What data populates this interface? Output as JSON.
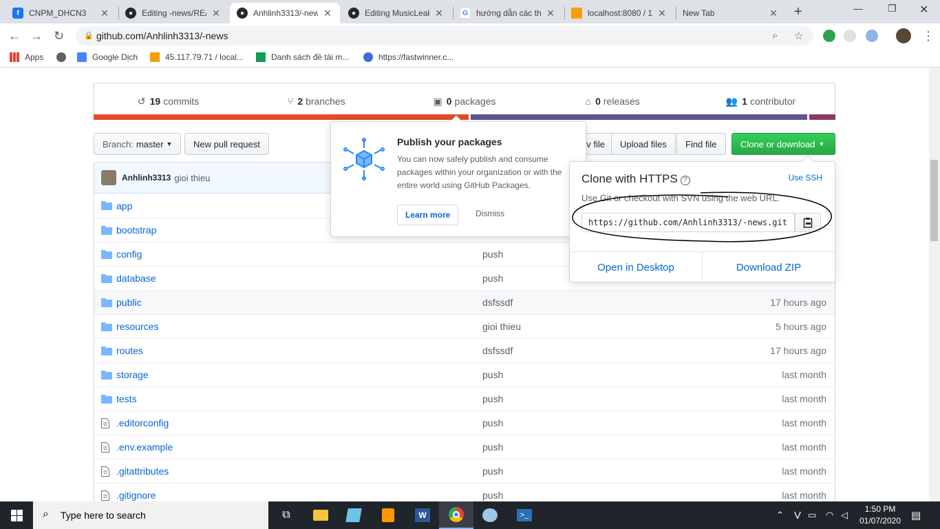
{
  "browser": {
    "tabs": [
      {
        "title": "CNPM_DHCN3",
        "icon": "facebook-icon"
      },
      {
        "title": "Editing -news/REA",
        "icon": "github-icon"
      },
      {
        "title": "Anhlinh3313/-new",
        "icon": "github-icon"
      },
      {
        "title": "Editing MusicLeak",
        "icon": "github-icon"
      },
      {
        "title": "hướng dẫn các tha",
        "icon": "google-icon"
      },
      {
        "title": "localhost:8080 / 1:",
        "icon": "phpmyadmin-icon"
      },
      {
        "title": "New Tab",
        "icon": ""
      }
    ],
    "new_tab": "+",
    "address": "github.com/Anhlinh3313/-news",
    "bookmarks": [
      "Apps",
      "Google Dịch",
      "45.117.79.71 / local...",
      "Danh sách đề tài m...",
      "https://fastwinner.c..."
    ]
  },
  "repo": {
    "summary": [
      {
        "count": "19",
        "label": "commits",
        "icon": "history-icon"
      },
      {
        "count": "2",
        "label": "branches",
        "icon": "branch-icon"
      },
      {
        "count": "0",
        "label": "packages",
        "icon": "package-icon"
      },
      {
        "count": "0",
        "label": "releases",
        "icon": "tag-icon"
      },
      {
        "count": "1",
        "label": "contributor",
        "icon": "people-icon"
      }
    ],
    "lang_colors": [
      "#e44b23",
      "#e44b23",
      "#e44b23",
      "#563d7c",
      "#563d7c",
      "#701516"
    ],
    "branch_label": "Branch:",
    "branch_name": "master",
    "new_pull_request": "New pull request",
    "create_file_partial": "v file",
    "upload_files": "Upload files",
    "find_file": "Find file",
    "clone_or_download": "Clone or download",
    "latest_commit": {
      "author": "Anhlinh3313",
      "message": "gioi thieu"
    },
    "files": [
      {
        "name": "app",
        "type": "dir",
        "message": "",
        "age": ""
      },
      {
        "name": "bootstrap",
        "type": "dir",
        "message": "",
        "age": ""
      },
      {
        "name": "config",
        "type": "dir",
        "message": "push",
        "age": ""
      },
      {
        "name": "database",
        "type": "dir",
        "message": "push",
        "age": ""
      },
      {
        "name": "public",
        "type": "dir",
        "message": "dsfssdf",
        "age": "17 hours ago"
      },
      {
        "name": "resources",
        "type": "dir",
        "message": "gioi thieu",
        "age": "5 hours ago"
      },
      {
        "name": "routes",
        "type": "dir",
        "message": "dsfssdf",
        "age": "17 hours ago"
      },
      {
        "name": "storage",
        "type": "dir",
        "message": "push",
        "age": "last month"
      },
      {
        "name": "tests",
        "type": "dir",
        "message": "push",
        "age": "last month"
      },
      {
        "name": ".editorconfig",
        "type": "file",
        "message": "push",
        "age": "last month"
      },
      {
        "name": ".env.example",
        "type": "file",
        "message": "push",
        "age": "last month"
      },
      {
        "name": ".gitattributes",
        "type": "file",
        "message": "push",
        "age": "last month"
      },
      {
        "name": ".gitignore",
        "type": "file",
        "message": "push",
        "age": "last month"
      }
    ]
  },
  "packages_popover": {
    "title": "Publish your packages",
    "body": "You can now safely publish and consume packages within your organization or with the entire world using GitHub Packages.",
    "learn_more": "Learn more",
    "dismiss": "Dismiss"
  },
  "clone_popover": {
    "title": "Clone with HTTPS",
    "help": "?",
    "use_ssh": "Use SSH",
    "description": "Use Git or checkout with SVN using the web URL.",
    "url": "https://github.com/Anhlinh3313/-news.git",
    "open_desktop": "Open in Desktop",
    "download_zip": "Download ZIP"
  },
  "taskbar": {
    "search_placeholder": "Type here to search",
    "time": "1:50 PM",
    "date": "01/07/2020",
    "ime": "V"
  }
}
